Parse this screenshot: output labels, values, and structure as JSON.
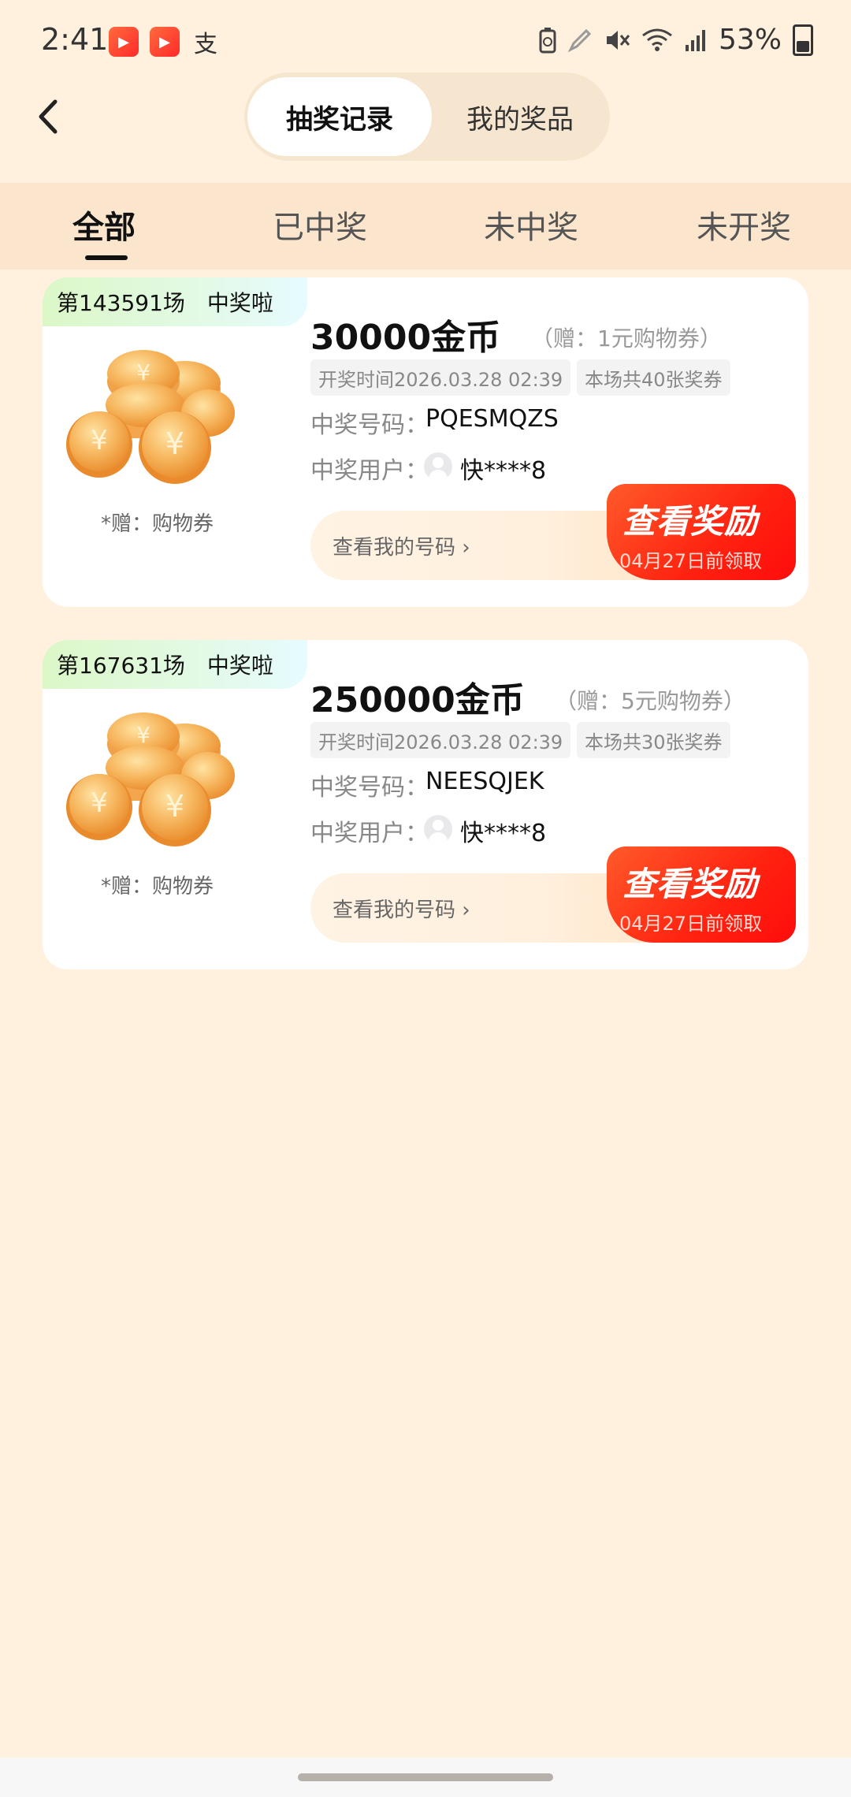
{
  "status_bar": {
    "time": "2:41",
    "battery": "53%",
    "icons": [
      "kuaishou-app-icon",
      "kuaishou-app-icon",
      "alipay-icon",
      "battery-saver-icon",
      "edit-pen-icon",
      "mute-icon",
      "wifi-icon",
      "signal-icon",
      "battery-icon"
    ]
  },
  "header": {
    "back_icon": "chevron-left-icon",
    "segments": [
      "抽奖记录",
      "我的奖品"
    ],
    "active_segment": "抽奖记录"
  },
  "tabs": {
    "items": [
      "全部",
      "已中奖",
      "未中奖",
      "未开奖"
    ],
    "active": "全部"
  },
  "cards": [
    {
      "round": "第143591场",
      "status": "中奖啦",
      "gift_note": "*赠：购物券",
      "prize": "30000金币",
      "bonus": "（赠：1元购物券）",
      "draw_time": "开奖时间2026.03.28 02:39",
      "ticket_count": "本场共40张奖券",
      "number_label": "中奖号码：",
      "number_value": "PQESMQZS",
      "user_label": "中奖用户：",
      "user_value": "快****8",
      "my_numbers": "查看我的号码 ›",
      "reward_button": "查看奖励",
      "deadline": "04月27日前领取"
    },
    {
      "round": "第167631场",
      "status": "中奖啦",
      "gift_note": "*赠：购物券",
      "prize": "250000金币",
      "bonus": "（赠：5元购物券）",
      "draw_time": "开奖时间2026.03.28 02:39",
      "ticket_count": "本场共30张奖券",
      "number_label": "中奖号码：",
      "number_value": "NEESQJEK",
      "user_label": "中奖用户：",
      "user_value": "快****8",
      "my_numbers": "查看我的号码 ›",
      "reward_button": "查看奖励",
      "deadline": "04月27日前领取"
    }
  ],
  "colors": {
    "background": "#fff1de",
    "accent_red": "#ff2210",
    "tab_bar": "#fbe6cd"
  }
}
